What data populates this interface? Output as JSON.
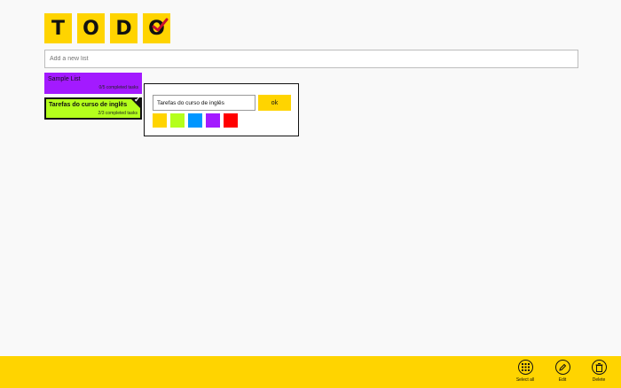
{
  "logo": {
    "letters": [
      "T",
      "O",
      "D",
      "O"
    ],
    "check_icon": "check-icon",
    "check_color": "#c8102e",
    "tile_color": "#ffd400"
  },
  "new_list": {
    "placeholder": "Add a new list"
  },
  "lists": [
    {
      "name": "Sample List",
      "count_text": "0/5 completed tasks",
      "color": "#a31aff",
      "selected": false
    },
    {
      "name": "Tarefas do curso de inglês",
      "count_text": "2/3 completed tasks",
      "color": "#b4ff1c",
      "selected": true
    }
  ],
  "edit_popup": {
    "value": "Tarefas do curso de inglês",
    "ok_label": "ok",
    "swatches": [
      "#ffd400",
      "#b4ff1c",
      "#0096ff",
      "#a31aff",
      "#ff0000"
    ]
  },
  "app_bar": {
    "color": "#ffd400",
    "buttons": [
      {
        "label": "Select all",
        "icon": "grid-icon"
      },
      {
        "label": "Edit",
        "icon": "pencil-icon"
      },
      {
        "label": "Delete",
        "icon": "trash-icon"
      }
    ]
  }
}
